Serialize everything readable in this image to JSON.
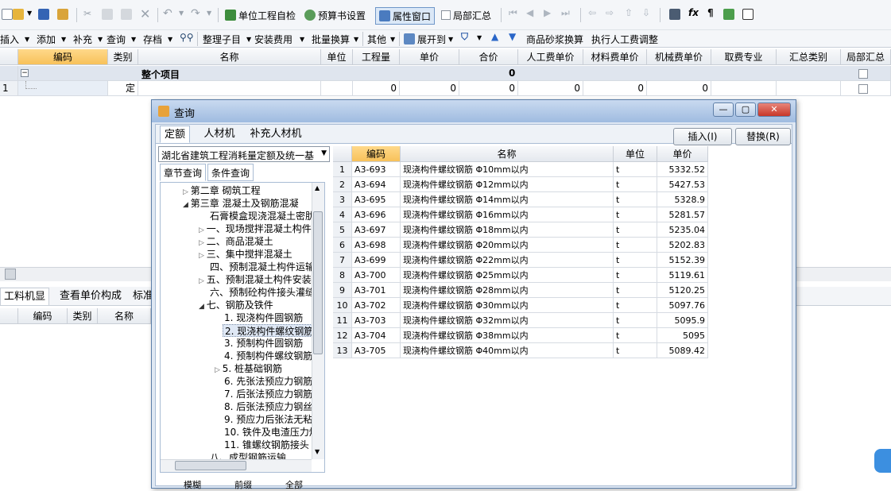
{
  "toolbar1": {
    "btn_self_check": "单位工程自检",
    "btn_budget_settings": "预算书设置",
    "btn_properties": "属性窗口",
    "btn_partial_summary": "局部汇总"
  },
  "toolbar2": {
    "insert": "插入",
    "add": "添加",
    "supplement": "补充",
    "query": "查询",
    "archive": "存档",
    "organize": "整理子目",
    "install_fee": "安装费用",
    "batch_convert": "批量换算",
    "other": "其他",
    "expand_to": "展开到",
    "mortar_convert": "商品砂浆换算",
    "labor_adjust": "执行人工费调整"
  },
  "main_grid": {
    "headers": [
      "编码",
      "类别",
      "名称",
      "单位",
      "工程量",
      "单价",
      "合价",
      "人工费单价",
      "材料费单价",
      "机械费单价",
      "取费专业",
      "汇总类别",
      "局部汇总"
    ],
    "summary_row": {
      "name": "整个项目",
      "total": "0"
    },
    "row1": {
      "index": "1",
      "type": "定",
      "quantity": "0",
      "price": "0",
      "total": "0",
      "labor": "0",
      "material": "0",
      "machine": "0"
    }
  },
  "bottom_panel": {
    "tab_labor_machine": "工料机显示",
    "tab_unit_price": "查看单价构成",
    "tab_standard": "标准",
    "headers": [
      "编码",
      "类别",
      "名称"
    ]
  },
  "dialog": {
    "title": "查询",
    "tabs": [
      "定额",
      "人材机",
      "补充人材机"
    ],
    "btn_insert": "插入(I)",
    "btn_replace": "替换(R)",
    "library_select": "湖北省建筑工程消耗量定额及统一基",
    "subtabs": [
      "章节查询",
      "条件查询"
    ],
    "tree": [
      "第二章 砌筑工程",
      "第三章 混凝土及钢筋混凝",
      "石膏模盒现浇混凝土密肋",
      "一、现场搅拌混凝土构件",
      "二、商品混凝土",
      "三、集中搅拌混凝土",
      "四、预制混凝土构件运输",
      "五、预制混凝土构件安装",
      "六、预制砼构件接头灌缝",
      "七、钢筋及铁件",
      "1. 现浇构件圆钢筋",
      "2. 现浇构件螺纹钢筋",
      "3. 预制构件圆钢筋",
      "4. 预制构件螺纹钢筋",
      "5. 桩基础钢筋",
      "6. 先张法预应力钢筋",
      "7. 后张法预应力钢筋",
      "8. 后张法预应力钢丝",
      "9. 预应力后张法无粘",
      "10. 铁件及电渣压力焊",
      "11. 锥螺纹钢筋接头",
      "八、成型钢筋运输"
    ],
    "bottom_options": [
      "模糊",
      "前缀",
      "全部"
    ],
    "table_headers": [
      "编码",
      "名称",
      "单位",
      "单价"
    ],
    "rows": [
      {
        "n": "1",
        "code": "A3-693",
        "name": "现浇构件螺纹钢筋 Φ10mm以内",
        "unit": "t",
        "price": "5332.52"
      },
      {
        "n": "2",
        "code": "A3-694",
        "name": "现浇构件螺纹钢筋 Φ12mm以内",
        "unit": "t",
        "price": "5427.53"
      },
      {
        "n": "3",
        "code": "A3-695",
        "name": "现浇构件螺纹钢筋 Φ14mm以内",
        "unit": "t",
        "price": "5328.9"
      },
      {
        "n": "4",
        "code": "A3-696",
        "name": "现浇构件螺纹钢筋 Φ16mm以内",
        "unit": "t",
        "price": "5281.57"
      },
      {
        "n": "5",
        "code": "A3-697",
        "name": "现浇构件螺纹钢筋 Φ18mm以内",
        "unit": "t",
        "price": "5235.04"
      },
      {
        "n": "6",
        "code": "A3-698",
        "name": "现浇构件螺纹钢筋 Φ20mm以内",
        "unit": "t",
        "price": "5202.83"
      },
      {
        "n": "7",
        "code": "A3-699",
        "name": "现浇构件螺纹钢筋 Φ22mm以内",
        "unit": "t",
        "price": "5152.39"
      },
      {
        "n": "8",
        "code": "A3-700",
        "name": "现浇构件螺纹钢筋 Φ25mm以内",
        "unit": "t",
        "price": "5119.61"
      },
      {
        "n": "9",
        "code": "A3-701",
        "name": "现浇构件螺纹钢筋 Φ28mm以内",
        "unit": "t",
        "price": "5120.25"
      },
      {
        "n": "10",
        "code": "A3-702",
        "name": "现浇构件螺纹钢筋 Φ30mm以内",
        "unit": "t",
        "price": "5097.76"
      },
      {
        "n": "11",
        "code": "A3-703",
        "name": "现浇构件螺纹钢筋 Φ32mm以内",
        "unit": "t",
        "price": "5095.9"
      },
      {
        "n": "12",
        "code": "A3-704",
        "name": "现浇构件螺纹钢筋 Φ38mm以内",
        "unit": "t",
        "price": "5095"
      },
      {
        "n": "13",
        "code": "A3-705",
        "name": "现浇构件螺纹钢筋 Φ40mm以内",
        "unit": "t",
        "price": "5089.42"
      }
    ]
  }
}
